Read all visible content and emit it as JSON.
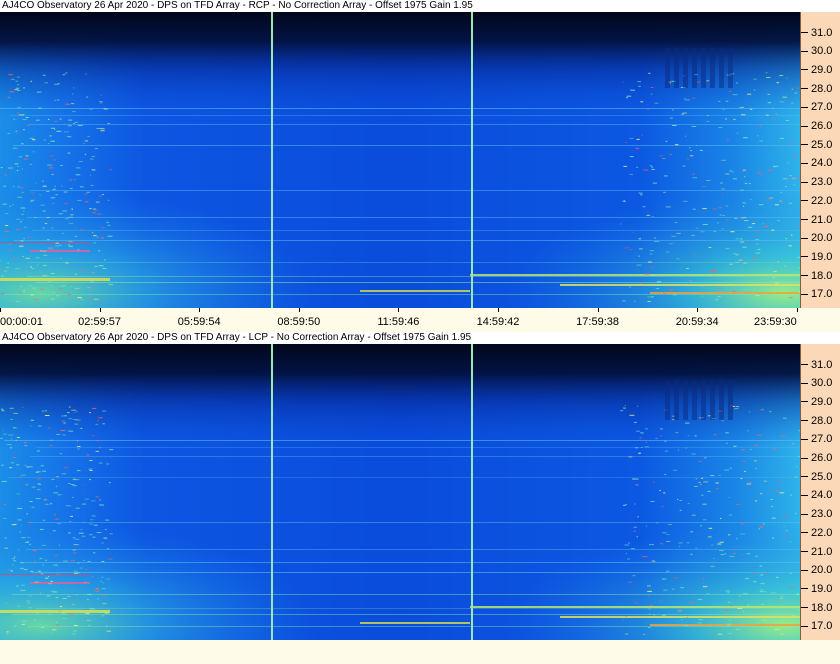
{
  "panels": [
    {
      "title": "AJ4CO Observatory 26 Apr 2020 - DPS on TFD Array   - RCP  -  No Correction Array  -  Offset 1975  Gain 1.95",
      "polarization": "RCP"
    },
    {
      "title": "AJ4CO Observatory 26 Apr 2020 - DPS on TFD Array   - LCP  -  No Correction Array  -  Offset 1975  Gain 1.95",
      "polarization": "LCP"
    }
  ],
  "y_ticks": [
    "31.0",
    "30.0",
    "29.0",
    "28.0",
    "27.0",
    "26.0",
    "25.0",
    "24.0",
    "23.0",
    "22.0",
    "21.0",
    "20.0",
    "19.0",
    "18.0",
    "17.0"
  ],
  "x_ticks": [
    "00:00:01",
    "02:59:57",
    "05:59:54",
    "08:59:50",
    "11:59:46",
    "14:59:42",
    "17:59:38",
    "20:59:34",
    "23:59:30"
  ],
  "colors": {
    "sky": "#0b4fe0",
    "deep": "#020a2a",
    "cursor_line": "#9de8b0",
    "axis_bg": "#fbd9b8"
  }
}
